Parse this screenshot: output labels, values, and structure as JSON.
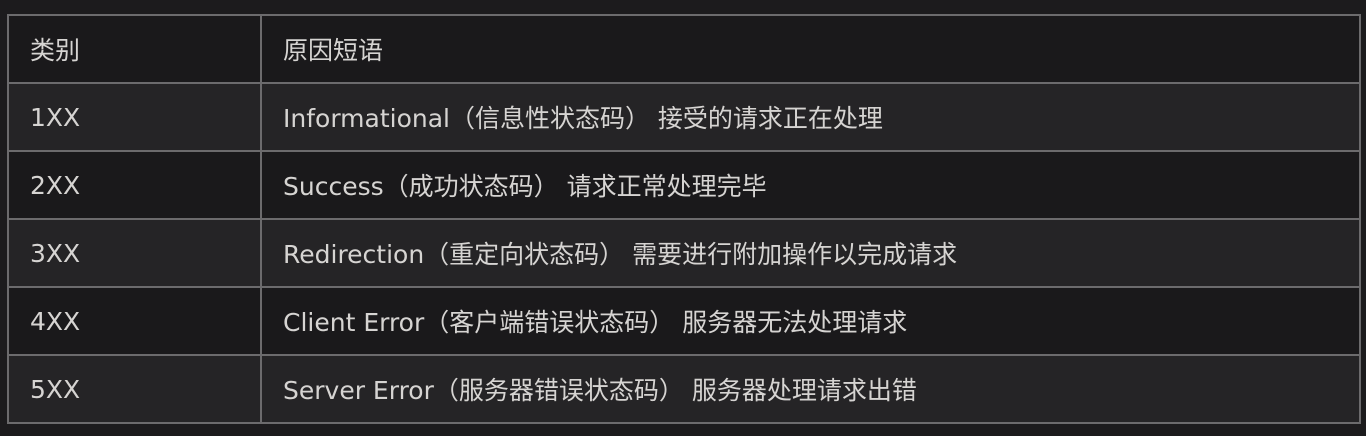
{
  "table": {
    "headers": [
      "类别",
      "原因短语"
    ],
    "rows": [
      [
        "1XX",
        "Informational（信息性状态码） 接受的请求正在处理"
      ],
      [
        "2XX",
        "Success（成功状态码） 请求正常处理完毕"
      ],
      [
        "3XX",
        "Redirection（重定向状态码） 需要进行附加操作以完成请求"
      ],
      [
        "4XX",
        "Client Error（客户端错误状态码） 服务器无法处理请求"
      ],
      [
        "5XX",
        "Server Error（服务器错误状态码） 服务器处理请求出错"
      ]
    ]
  }
}
